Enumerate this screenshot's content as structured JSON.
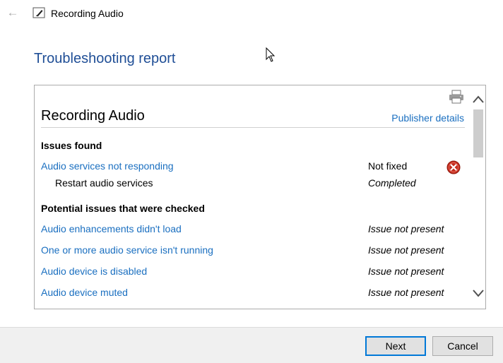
{
  "window": {
    "title": "Recording Audio"
  },
  "page": {
    "heading": "Troubleshooting report"
  },
  "report": {
    "title": "Recording Audio",
    "publisher_link": "Publisher details",
    "issues_found": {
      "heading": "Issues found",
      "items": [
        {
          "label": "Audio services not responding",
          "status": "Not fixed",
          "icon": "error-x-icon"
        },
        {
          "label": "Restart audio services",
          "status": "Completed"
        }
      ]
    },
    "checked": {
      "heading": "Potential issues that were checked",
      "items": [
        {
          "label": "Audio enhancements didn't load",
          "status": "Issue not present"
        },
        {
          "label": "One or more audio service isn't running",
          "status": "Issue not present"
        },
        {
          "label": "Audio device is disabled",
          "status": "Issue not present"
        },
        {
          "label": "Audio device muted",
          "status": "Issue not present"
        }
      ]
    }
  },
  "footer": {
    "next_label": "Next",
    "cancel_label": "Cancel"
  },
  "colors": {
    "heading_blue": "#1f4e96",
    "link_blue": "#1a6fc0",
    "error_red": "#c42b1c",
    "focus_blue": "#0078d7"
  }
}
